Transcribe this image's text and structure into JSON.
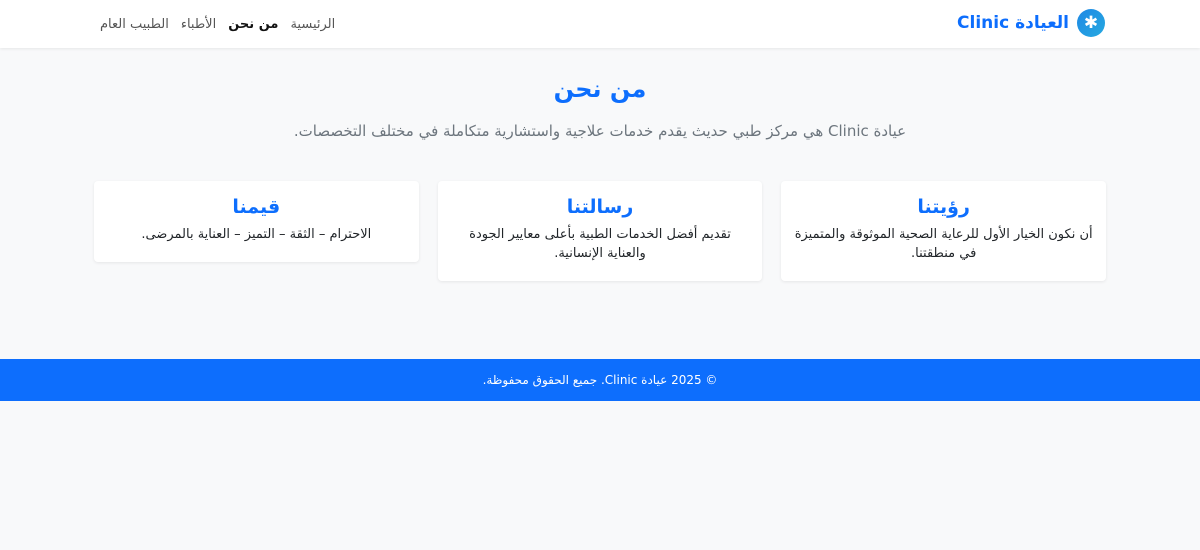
{
  "navbar": {
    "brand_text": "العيادة Clinic",
    "brand_icon": "star-medical-icon",
    "links": [
      {
        "label": "الرئيسية",
        "active": false
      },
      {
        "label": "من نحن",
        "active": true
      },
      {
        "label": "الأطباء",
        "active": false
      },
      {
        "label": "الطبيب العام",
        "active": false
      }
    ]
  },
  "hero": {
    "title": "من نحن",
    "intro": "عيادة Clinic هي مركز طبي حديث يقدم خدمات علاجية واستشارية متكاملة في مختلف التخصصات."
  },
  "cards": [
    {
      "title": "رؤيتنا",
      "text": "أن نكون الخيار الأول للرعاية الصحية الموثوقة والمتميزة في منطقتنا."
    },
    {
      "title": "رسالتنا",
      "text": "تقديم أفضل الخدمات الطبية بأعلى معايير الجودة والعناية الإنسانية."
    },
    {
      "title": "قيمنا",
      "text": "الاحترام – الثقة – التميز – العناية بالمرضى."
    }
  ],
  "footer": {
    "text": "© 2025 عيادة Clinic. جميع الحقوق محفوظة."
  },
  "colors": {
    "accent": "#0d6efd",
    "background": "#f8f9fa"
  }
}
